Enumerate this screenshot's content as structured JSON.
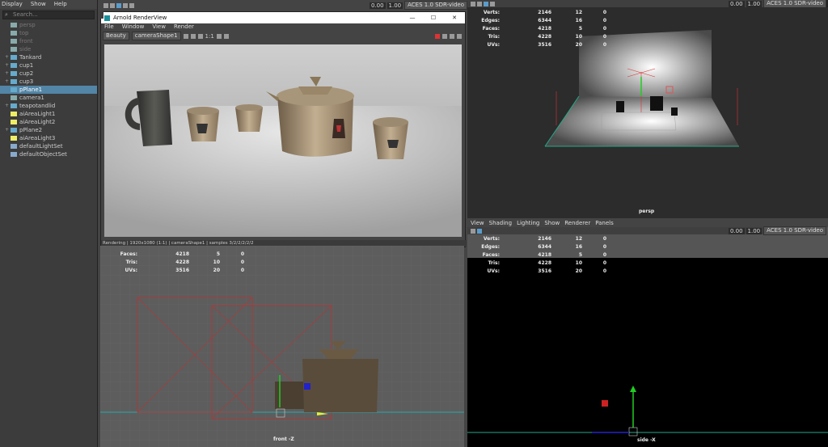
{
  "outliner": {
    "menu": [
      "Display",
      "Show",
      "Help"
    ],
    "search_placeholder": "Search...",
    "items": [
      {
        "label": "persp",
        "icon": "camera-icon",
        "dim": true
      },
      {
        "label": "top",
        "icon": "camera-icon",
        "dim": true
      },
      {
        "label": "front",
        "icon": "camera-icon",
        "dim": true
      },
      {
        "label": "side",
        "icon": "camera-icon",
        "dim": true
      },
      {
        "label": "Tankard",
        "icon": "mesh-icon"
      },
      {
        "label": "cup1",
        "icon": "mesh-icon"
      },
      {
        "label": "cup2",
        "icon": "mesh-icon"
      },
      {
        "label": "cup3",
        "icon": "mesh-icon"
      },
      {
        "label": "pPlane1",
        "icon": "mesh-icon",
        "selected": true
      },
      {
        "label": "camera1",
        "icon": "camera-icon"
      },
      {
        "label": "teapotandlid",
        "icon": "mesh-icon"
      },
      {
        "label": "aiAreaLight1",
        "icon": "light-icon"
      },
      {
        "label": "aiAreaLight2",
        "icon": "light-icon"
      },
      {
        "label": "pPlane2",
        "icon": "mesh-icon"
      },
      {
        "label": "aiAreaLight3",
        "icon": "light-icon"
      },
      {
        "label": "defaultLightSet",
        "icon": "set-icon"
      },
      {
        "label": "defaultObjectSet",
        "icon": "set-icon"
      }
    ]
  },
  "toolbar": {
    "left": {
      "value1": "0.00",
      "value2": "1.00",
      "colorspace": "ACES 1.0 SDR-video"
    },
    "right": {
      "value1": "0.00",
      "value2": "1.00",
      "colorspace": "ACES 1.0 SDR-video"
    },
    "right_bottom": {
      "value1": "0.00",
      "value2": "1.00",
      "colorspace": "ACES 1.0 SDR-video"
    }
  },
  "render_view": {
    "title": "Arnold RenderView",
    "menus": [
      "File",
      "Window",
      "View",
      "Render"
    ],
    "aov": "Beauty",
    "camera": "cameraShape1",
    "ratio": "1:1",
    "status": "Rendering | 1920x1080 (1:1) | cameraShape1 | samples 3/2/2/2/2/2"
  },
  "hud_persp": {
    "rows": [
      {
        "label": "Verts:",
        "v1": "2146",
        "v2": "12",
        "v3": "0"
      },
      {
        "label": "Edges:",
        "v1": "6344",
        "v2": "16",
        "v3": "0"
      },
      {
        "label": "Faces:",
        "v1": "4218",
        "v2": "5",
        "v3": "0"
      },
      {
        "label": "Tris:",
        "v1": "4228",
        "v2": "10",
        "v3": "0"
      },
      {
        "label": "UVs:",
        "v1": "3516",
        "v2": "20",
        "v3": "0"
      }
    ]
  },
  "hud_front": {
    "rows": [
      {
        "label": "Faces:",
        "v1": "4218",
        "v2": "5",
        "v3": "0"
      },
      {
        "label": "Tris:",
        "v1": "4228",
        "v2": "10",
        "v3": "0"
      },
      {
        "label": "UVs:",
        "v1": "3516",
        "v2": "20",
        "v3": "0"
      }
    ]
  },
  "hud_side": {
    "rows": [
      {
        "label": "Verts:",
        "v1": "2146",
        "v2": "12",
        "v3": "0"
      },
      {
        "label": "Edges:",
        "v1": "6344",
        "v2": "16",
        "v3": "0"
      },
      {
        "label": "Faces:",
        "v1": "4218",
        "v2": "5",
        "v3": "0"
      },
      {
        "label": "Tris:",
        "v1": "4228",
        "v2": "10",
        "v3": "0"
      },
      {
        "label": "UVs:",
        "v1": "3516",
        "v2": "20",
        "v3": "0"
      }
    ]
  },
  "viewport_menus": [
    "View",
    "Shading",
    "Lighting",
    "Show",
    "Renderer",
    "Panels"
  ],
  "labels": {
    "persp": "persp",
    "front": "front -Z",
    "side": "side -X"
  }
}
